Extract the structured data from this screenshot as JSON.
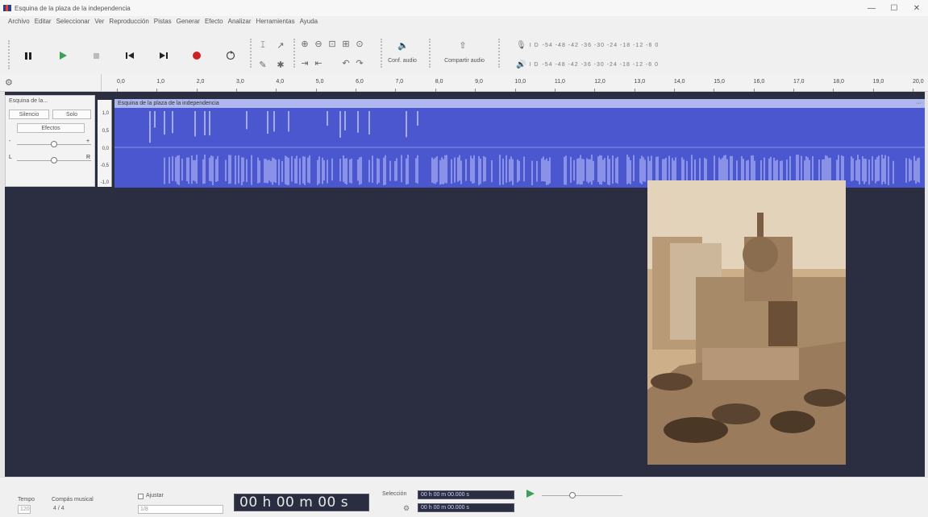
{
  "window": {
    "title": "Esquina de la plaza de la independencia",
    "minimize": "—",
    "maximize": "☐",
    "close": "✕"
  },
  "menu": [
    "Archivo",
    "Editar",
    "Seleccionar",
    "Ver",
    "Reproducción",
    "Pistas",
    "Generar",
    "Efecto",
    "Analizar",
    "Herramientas",
    "Ayuda"
  ],
  "toolbar": {
    "audio_setup_label": "Conf. audio",
    "share_audio_label": "Compartir audio",
    "meter_scale": "-54 -48 -42 -36 -30 -24 -18 -12 -6 0",
    "rec_meter_label": "I D",
    "play_meter_label": "I D"
  },
  "ruler": {
    "ticks": [
      "0,0",
      "1,0",
      "2,0",
      "3,0",
      "4,0",
      "5,0",
      "6,0",
      "7,0",
      "8,0",
      "9,0",
      "10,0",
      "11,0",
      "12,0",
      "13,0",
      "14,0",
      "15,0",
      "16,0",
      "17,0",
      "18,0",
      "19,0",
      "20,0"
    ]
  },
  "track": {
    "name": "Esquina de la...",
    "mute_label": "Silencio",
    "solo_label": "Solo",
    "effects_label": "Efectos",
    "gain_min": "-",
    "gain_max": "+",
    "pan_left": "L",
    "pan_right": "R",
    "gain_value": 0.5,
    "pan_value": 0.5,
    "amplitude_labels": [
      "1,0",
      "0,5",
      "0,0",
      "-0,5",
      "-1,0"
    ]
  },
  "clip": {
    "title": "Esquina de la plaza de la independencia",
    "menu": "···",
    "color": "#4b57cf"
  },
  "bottom": {
    "tempo_label": "Tempo",
    "tempo_value": "120",
    "time_signature_label": "Compás musical",
    "time_signature_value": "4 / 4",
    "snap_label": "Ajustar",
    "snap_value": "1/8",
    "time_display": "00 h 00 m 00 s",
    "selection_label": "Selección",
    "selection_start": "00 h 00 m 00.000 s",
    "selection_end": "00 h 00 m 00.000 s"
  },
  "colors": {
    "accent": "#4b57cf",
    "record": "#cc2222",
    "play": "#3aa05a",
    "background": "#2b2e40"
  }
}
